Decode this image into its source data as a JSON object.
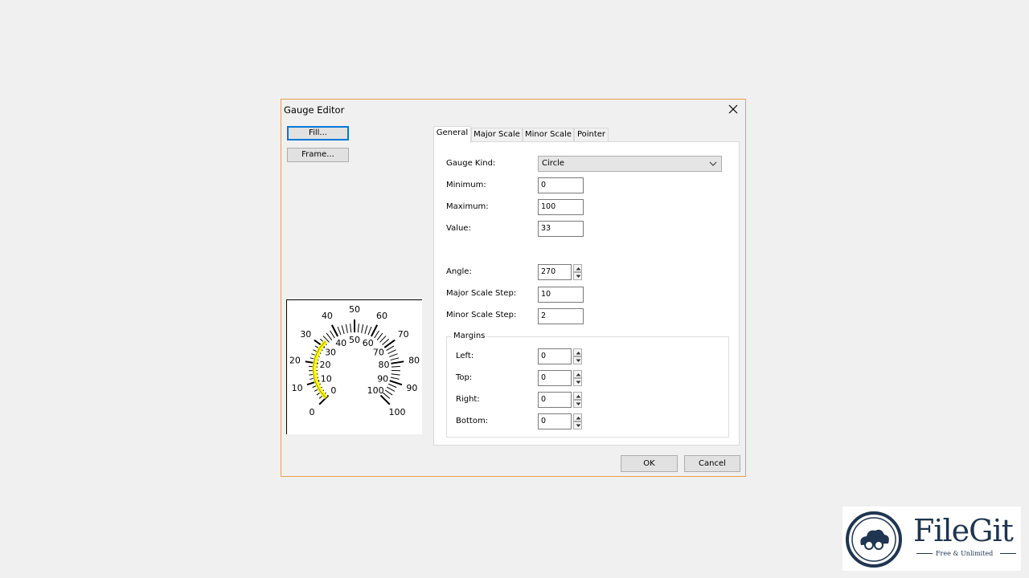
{
  "dialog": {
    "title": "Gauge Editor",
    "fill_label": "Fill...",
    "frame_label": "Frame...",
    "ok_label": "OK",
    "cancel_label": "Cancel"
  },
  "tabs": [
    {
      "label": "General",
      "active": true
    },
    {
      "label": "Major Scale",
      "active": false
    },
    {
      "label": "Minor Scale",
      "active": false
    },
    {
      "label": "Pointer",
      "active": false
    }
  ],
  "general": {
    "gauge_kind_label": "Gauge Kind:",
    "gauge_kind_value": "Circle",
    "minimum_label": "Minimum:",
    "minimum_value": "0",
    "maximum_label": "Maximum:",
    "maximum_value": "100",
    "value_label": "Value:",
    "value_value": "33",
    "angle_label": "Angle:",
    "angle_value": "270",
    "major_step_label": "Major Scale Step:",
    "major_step_value": "10",
    "minor_step_label": "Minor Scale Step:",
    "minor_step_value": "2",
    "margins": {
      "title": "Margins",
      "left_label": "Left:",
      "left_value": "0",
      "top_label": "Top:",
      "top_value": "0",
      "right_label": "Right:",
      "right_value": "0",
      "bottom_label": "Bottom:",
      "bottom_value": "0"
    }
  },
  "preview": {
    "outer_labels": [
      "0",
      "10",
      "20",
      "30",
      "40",
      "50",
      "60",
      "70",
      "80",
      "90",
      "100"
    ],
    "inner_labels": [
      "0",
      "10",
      "20",
      "30",
      "40",
      "50",
      "60",
      "70",
      "80",
      "90",
      "100"
    ],
    "pointer_color": "#ffff00"
  },
  "watermark": {
    "brand": "FileGit",
    "tagline": "Free & Unlimited"
  },
  "colors": {
    "dialog_border": "#e8a04a",
    "focus_border": "#0078d7"
  }
}
